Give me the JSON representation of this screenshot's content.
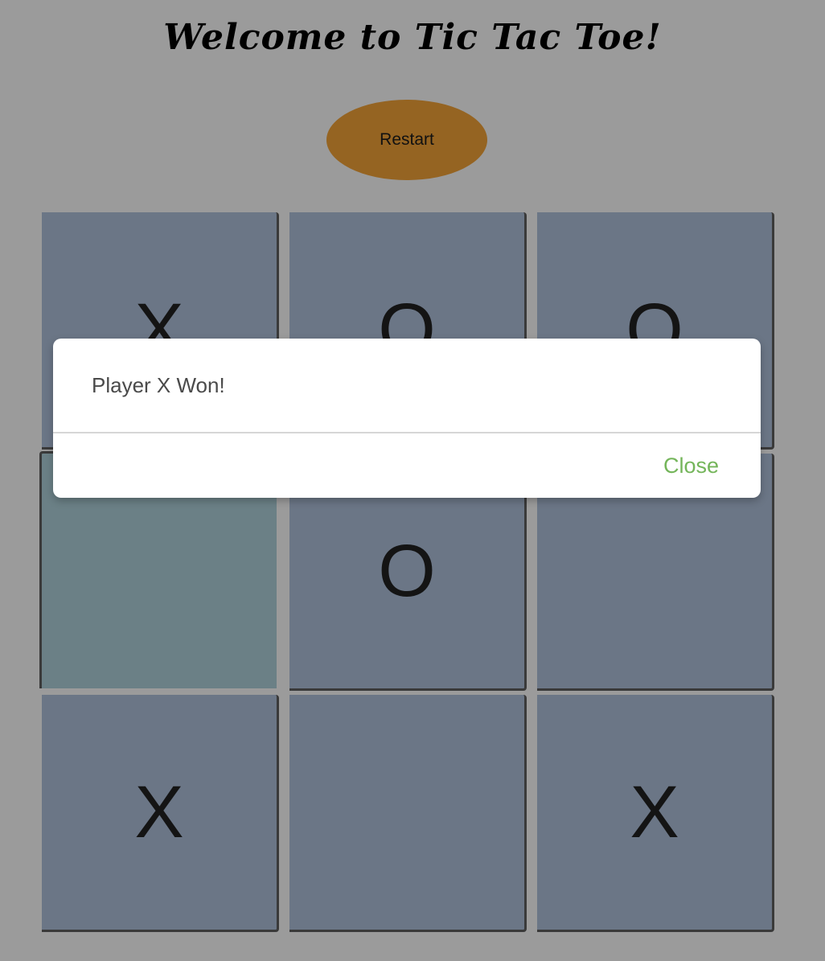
{
  "header": {
    "title": "Welcome to Tic Tac Toe!"
  },
  "controls": {
    "restart_label": "Restart"
  },
  "board": {
    "cells": [
      "X",
      "O",
      "O",
      "",
      "O",
      "",
      "X",
      "",
      "X"
    ]
  },
  "modal": {
    "message": "Player X Won!",
    "close_label": "Close"
  },
  "colors": {
    "background": "#9b9b9b",
    "restart_button": "#956422",
    "cell": "#6b7686",
    "highlighted_cell": "#6b8086",
    "close_accent": "#74b55a"
  }
}
